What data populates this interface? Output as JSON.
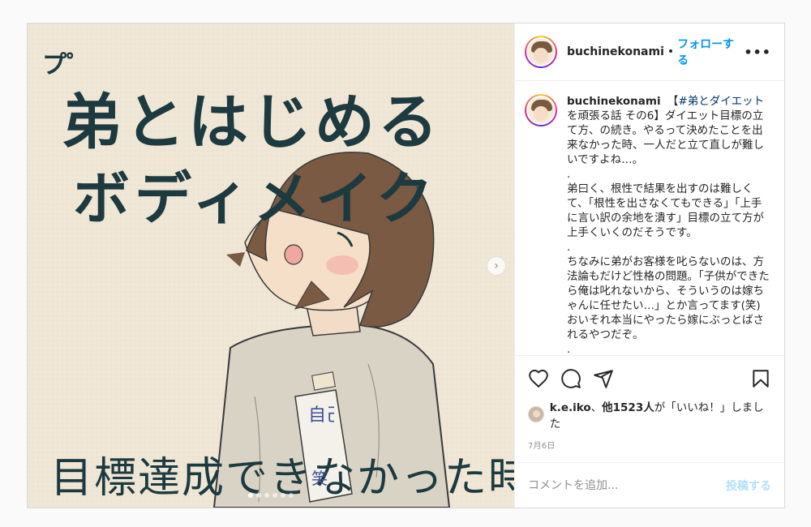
{
  "post": {
    "image": {
      "pu_text": "プ゜",
      "title_line1": "弟とはじめる",
      "title_line2": "ボディメイク",
      "bottom_caption": "目標達成できなかった時は",
      "tag_text": "自己",
      "tag_text2": "笑",
      "slide_count": 6,
      "active_slide": 1
    },
    "header": {
      "username": "buchinekonami",
      "separator": "•",
      "follow_label": "フォローする",
      "more_label": "•••"
    },
    "caption": {
      "username": "buchinekonami",
      "hashtag_prefix": "【",
      "hashtag": "#弟とダイエット",
      "body": "を頑張る話 その6】ダイエット目標の立て方、の続き。やるって決めたことを出来なかった時、一人だと立て直しが難しいですよね…。\n.\n弟曰く、根性で結果を出すのは難しくて、「根性を出さなくてもできる」「上手に言い訳の余地を潰す」目標の立て方が上手くいくのだそうです。\n.\nちなみに弟がお客様を叱らないのは、方法論もだけど性格の問題。「子供ができたら俺は叱れないから、そういうのは嫁ちゃんに任せたい…」とか言ってます(笑)おいそれ本当にやったら嫁にぶっとばされるやつだぞ。\n.\nそんな優しい弟のジム情報です☺"
    },
    "likes": {
      "first_user": "k.e.iko",
      "connector": "、",
      "others": "他1523人",
      "suffix": "が「いいね！」しました"
    },
    "date": "7月6日",
    "comment": {
      "placeholder": "コメントを追加...",
      "post_label": "投稿する"
    },
    "colors": {
      "accent_blue": "#0095f6",
      "post_disabled": "#b2dffc",
      "ink": "#1d3a40",
      "paper": "#efe6d6"
    }
  }
}
